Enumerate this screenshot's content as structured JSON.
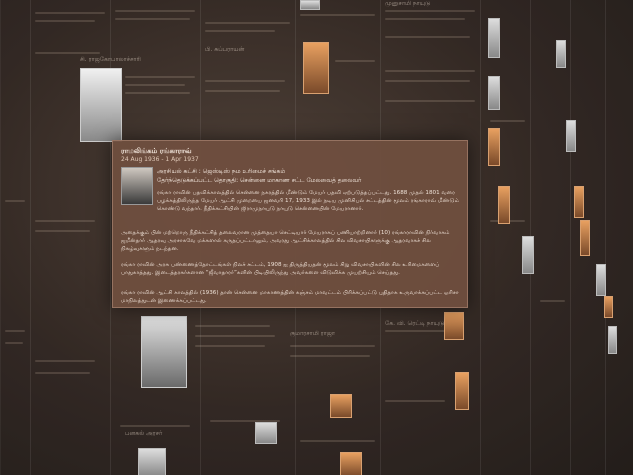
{
  "popup": {
    "name": "ராமலிங்கம் ரங்காராவ்",
    "dates": "24 Aug 1936 - 1 Apr 1937",
    "role_1": "அரசியல் கட்சி : ஜெஸ்டிஸ் நம உரிமைச் சங்கம்",
    "role_2": "தேர்ந்தெடுக்கப்பட்ட தொகுதி: சென்னை மாகாண சட்ட மேலவைத் தலைவர்",
    "para_1": "ரங்கா ராவின் பதவிக்காலத்தில் சென்னை நகரத்தில் மீண்டும் மேயர் பதவி ஏற்படுத்தப்பட்டது. 1688 முதல் 1801 வரை பழக்கத்திலிருந்த மேயர் ஆட்சி முறையை ஜனவரி 17, 1933 இல் நடிய முனிசிபல் சட்டத்தின் மூலம் ரங்காராவ் மீண்டும் கொண்டு வந்தார். நீதிக்கட்சியின் ஜிராமுநாயுடு நாயுடு சென்னையின் மேயரானார்.",
    "para_2": "அதைக்கும் பின் மற்றொரு நீதிக்கட்சித் தலைவரான முத்தையா செட்டியார் மேயராகப் பணியாற்றினார் (10) ரங்காராவின் நிர்வாகம் ஜமீன்தார் ஆதரவு அரசாகவே மக்களால் கருதப்பட்டாலும், அவரது ஆட்சிக்காலத்தில் சில விவசாயிகளுக்கு ஆதரவாகச் சில நிகழ்வுகளும் நடந்தன.",
    "para_3": "ரங்கா ராவின் அரசு பண்ணைத்தோட்டங்கள் நிலச் சட்டம், 1908 ஐ திருத்தியதன் மூலம் சிறு விவசாயிகளின் சில உரிமைகளைப் பாதுகாத்தது. இடைத்தரகர்களான “ஜீவாதாரர்”களின் பிடியிலிருந்து அவர்களை விடுவிக்க முயற்சியும் செய்தது.",
    "para_4": "ரங்கா ராவின் ஆட்சி காலத்தில் (1936) தான் சென்னை மாகாணத்தின் கஞ்சம் மாவட்டம் பிரிக்கப்பட்டு புதிதாக உருவாக்கப்பட்ட ஒரிசா மாநிலத்துடன் இணைக்கப்பட்டது."
  },
  "background_cards": {
    "title_1": "சி. ராஜகோபாலாச்சாரி",
    "title_2": "பி. சுப்பராயன்",
    "title_3": "முனுசாமி நாயுடு",
    "title_4": "கே. வி. ரெட்டி நாயுடு",
    "title_5": "பனகல் அரசர்",
    "title_6": "குமாரசாமி ராஜா"
  }
}
